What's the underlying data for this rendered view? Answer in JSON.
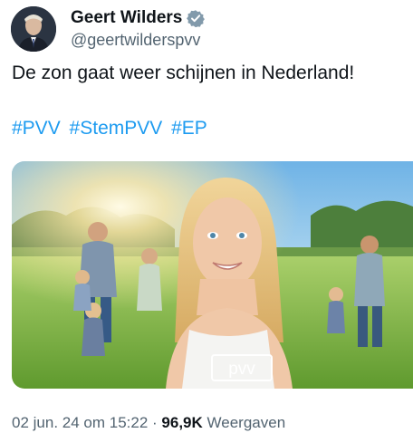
{
  "author": {
    "display_name": "Geert Wilders",
    "handle": "@geertwilderspvv",
    "avatar_icon": "avatar-photo",
    "verified_icon": "verified-badge-icon",
    "verified_color": "#829aab"
  },
  "tweet": {
    "text": "De zon gaat weer schijnen in Nederland!",
    "hashtags": [
      "#PVV",
      "#StemPVV",
      "#EP"
    ]
  },
  "media": {
    "overlay_logo_text": "pvv"
  },
  "meta": {
    "date": "02 jun. 24 om 15:22",
    "separator": "·",
    "views_count": "96,9K",
    "views_label": "Weergaven"
  },
  "colors": {
    "link": "#1d9bf0",
    "secondary_text": "#536471",
    "primary_text": "#0f1419"
  }
}
